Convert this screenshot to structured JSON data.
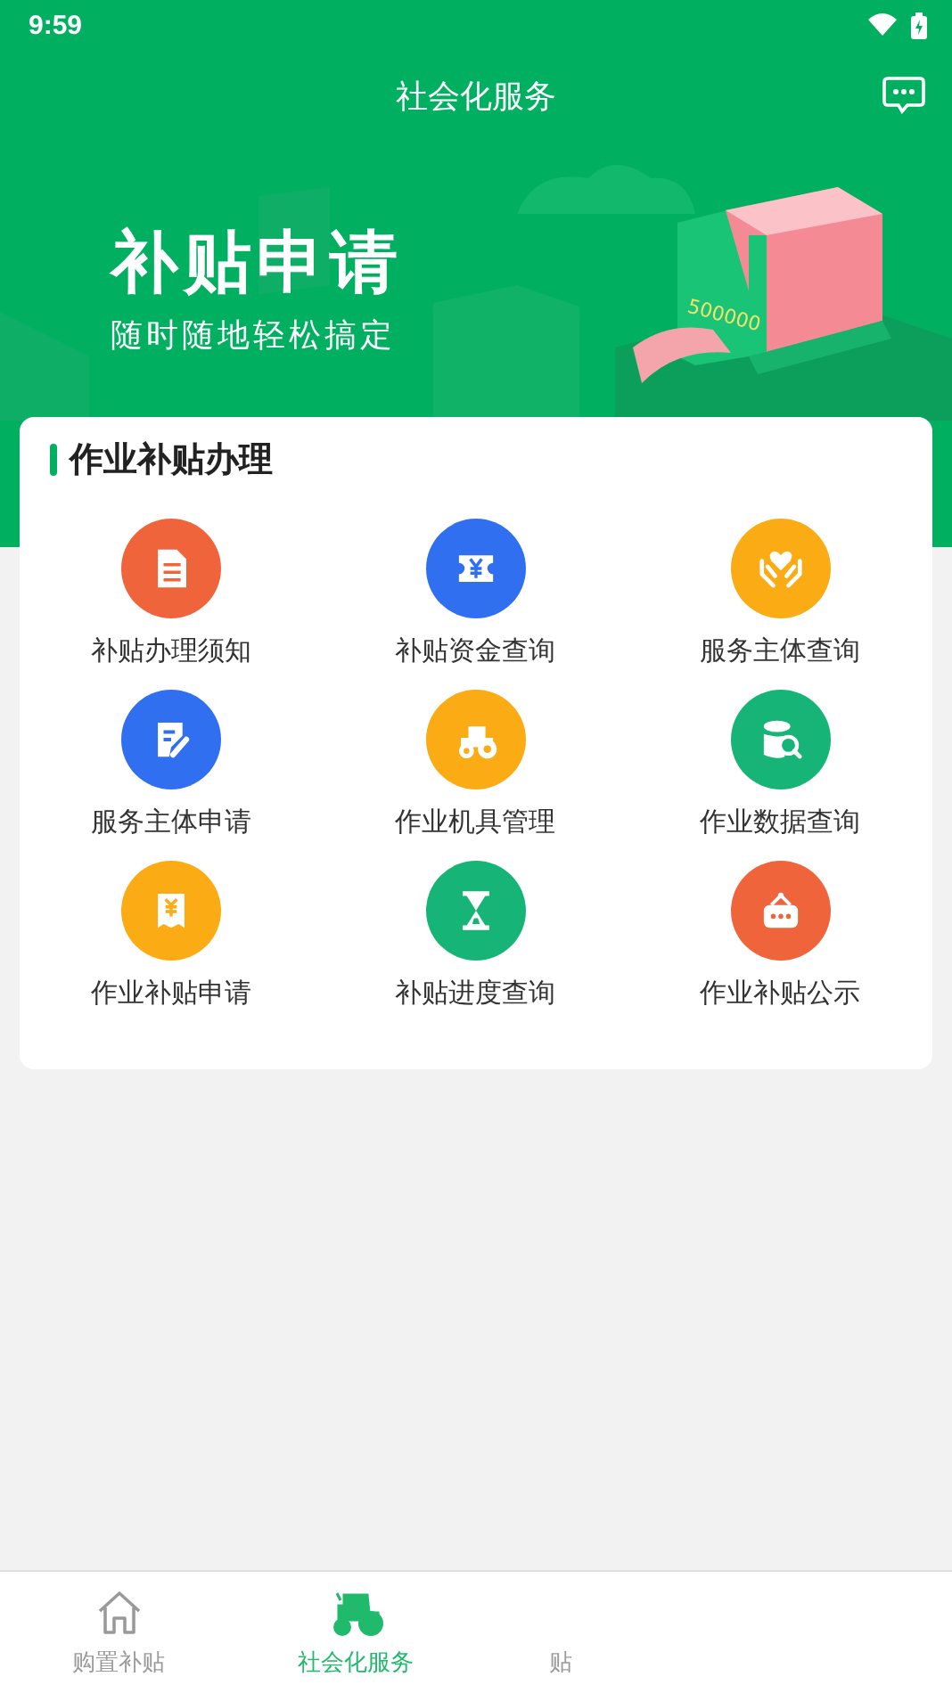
{
  "status_bar": {
    "time": "9:59"
  },
  "header": {
    "title": "社会化服务"
  },
  "banner": {
    "title": "补贴申请",
    "subtitle": "随时随地轻松搞定",
    "amount": "500000"
  },
  "section": {
    "title": "作业补贴办理",
    "items": [
      {
        "label": "补贴办理须知",
        "kind": "document",
        "color": "#f0643c"
      },
      {
        "label": "补贴资金查询",
        "kind": "ticket",
        "color": "#2f6ff0"
      },
      {
        "label": "服务主体查询",
        "kind": "hands",
        "color": "#fbab14"
      },
      {
        "label": "服务主体申请",
        "kind": "edit",
        "color": "#2f6ff0"
      },
      {
        "label": "作业机具管理",
        "kind": "tractor",
        "color": "#fbab14"
      },
      {
        "label": "作业数据查询",
        "kind": "database",
        "color": "#16b577"
      },
      {
        "label": "作业补贴申请",
        "kind": "receipt",
        "color": "#fbab14"
      },
      {
        "label": "补贴进度查询",
        "kind": "hourglass",
        "color": "#16b577"
      },
      {
        "label": "作业补贴公示",
        "kind": "sign",
        "color": "#f0643c"
      }
    ]
  },
  "tab_bar": [
    {
      "label": "购置补贴",
      "kind": "home",
      "selected": false
    },
    {
      "label": "社会化服务",
      "kind": "tractor",
      "selected": true
    },
    {
      "label": "贴",
      "kind": "hidden",
      "selected": false
    }
  ]
}
